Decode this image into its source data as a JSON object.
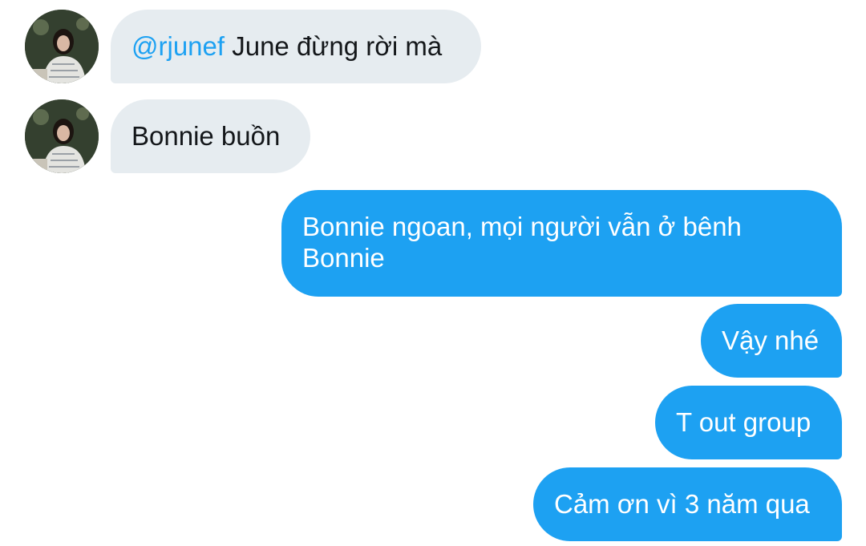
{
  "colors": {
    "incoming_bubble": "#e6ecf0",
    "outgoing_bubble": "#1da1f2",
    "mention": "#1da1f2",
    "text_dark": "#14171a"
  },
  "messages": [
    {
      "direction": "incoming",
      "mention": "@rjunef",
      "text": " June đừng rời mà",
      "avatar": "user-avatar"
    },
    {
      "direction": "incoming",
      "text": "Bonnie buồn",
      "avatar": "user-avatar"
    },
    {
      "direction": "outgoing",
      "text": "Bonnie ngoan, mọi người vẫn ở bênh Bonnie"
    },
    {
      "direction": "outgoing",
      "text": "Vậy nhé"
    },
    {
      "direction": "outgoing",
      "text": "T out group"
    },
    {
      "direction": "outgoing",
      "text": "Cảm ơn vì 3 năm qua"
    }
  ]
}
